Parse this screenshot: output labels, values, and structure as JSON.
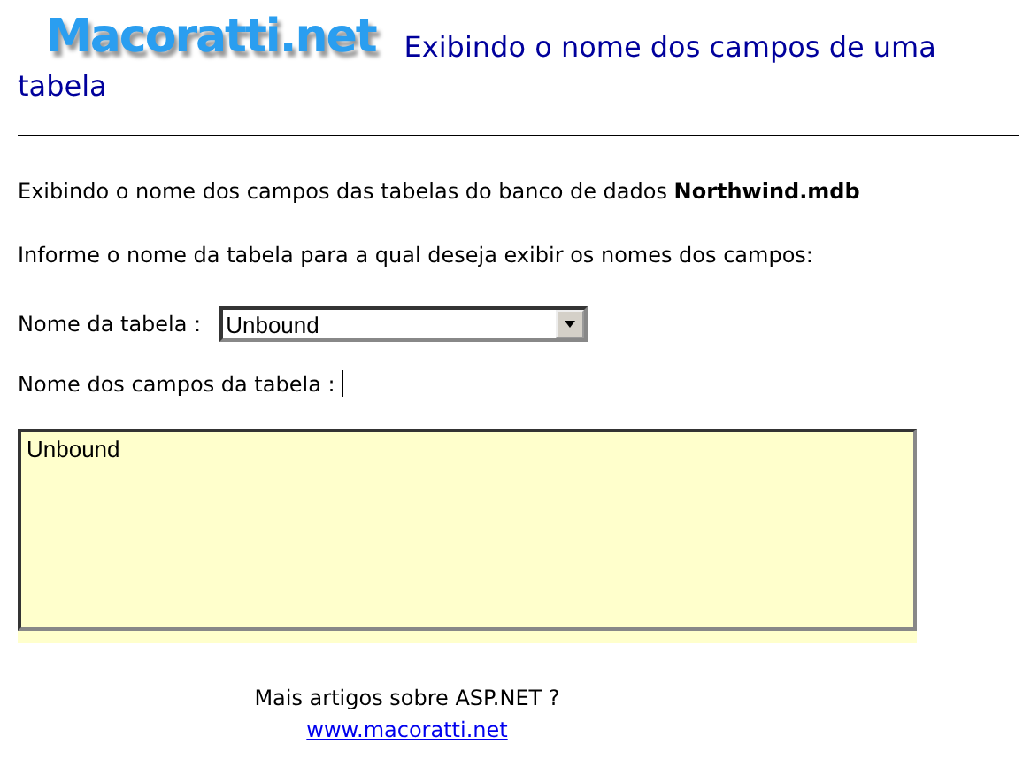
{
  "header": {
    "logo": "Macoratti.net",
    "title_lines": [
      "Exibindo o nome dos campos de uma",
      "tabela"
    ]
  },
  "intro": "Exibindo o nome dos campos das tabelas do banco de dados **Northwind.mdb**",
  "instruction": "Informe o nome da tabela para a qual deseja exibir os nomes dos campos:",
  "table_select": {
    "label": "Nome da tabela :",
    "value": "Unbound"
  },
  "fields_label": "Nome dos campos da tabela :",
  "fields_output": {
    "value": "Unbound"
  },
  "footer": {
    "text": "Mais artigos sobre ASP.NET ?",
    "link": "www.macoratti.net"
  }
}
